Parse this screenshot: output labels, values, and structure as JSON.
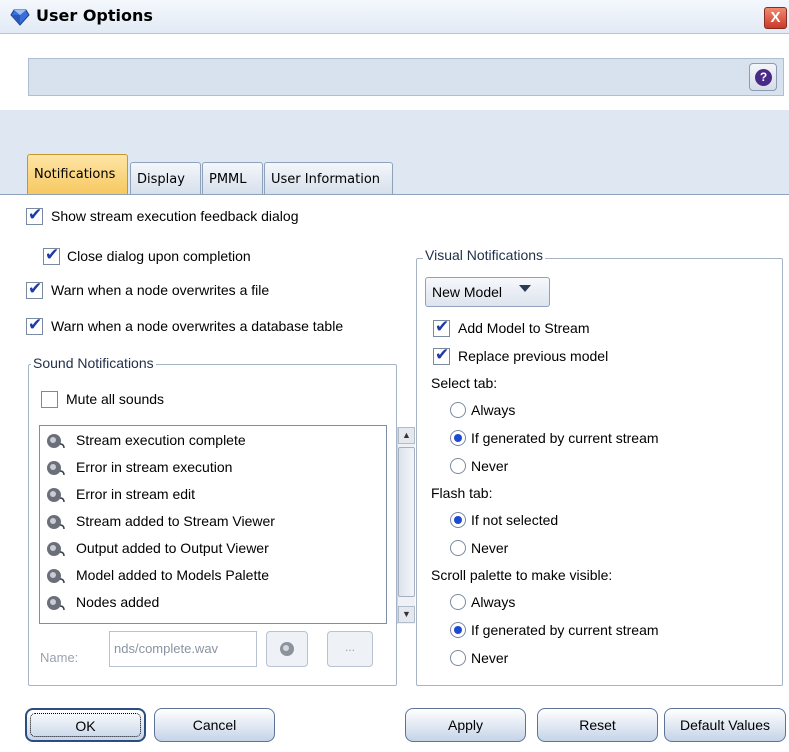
{
  "window": {
    "title": "User Options",
    "close_label": "X",
    "help_label": "?"
  },
  "tabs": [
    {
      "label": "Notifications",
      "active": true
    },
    {
      "label": "Display",
      "active": false
    },
    {
      "label": "PMML",
      "active": false
    },
    {
      "label": "User Information",
      "active": false
    }
  ],
  "left": {
    "show_feedback": {
      "label": "Show stream execution feedback dialog",
      "checked": true
    },
    "close_dialog": {
      "label": "Close dialog upon completion",
      "checked": true
    },
    "warn_file": {
      "label": "Warn when a node overwrites a file",
      "checked": true
    },
    "warn_table": {
      "label": "Warn when a node overwrites a database table",
      "checked": true
    }
  },
  "sound": {
    "title": "Sound Notifications",
    "mute": {
      "label": "Mute all sounds",
      "checked": false
    },
    "items": [
      "Stream execution complete",
      "Error in stream execution",
      "Error in stream edit",
      "Stream added to Stream Viewer",
      "Output added to Output Viewer",
      "Model added to Models Palette",
      "Nodes added"
    ],
    "name_label": "Name:",
    "name_value": "nds/complete.wav",
    "browse_label": "..."
  },
  "visual": {
    "title": "Visual Notifications",
    "dropdown_value": "New Model",
    "add_model": {
      "label": "Add Model to Stream",
      "checked": true
    },
    "replace_model": {
      "label": "Replace previous model",
      "checked": true
    },
    "select_tab": {
      "label": "Select tab:",
      "options": [
        "Always",
        "If generated by current stream",
        "Never"
      ],
      "selected": 1
    },
    "flash_tab": {
      "label": "Flash tab:",
      "options": [
        "If not selected",
        "Never"
      ],
      "selected": 0
    },
    "scroll_palette": {
      "label": "Scroll palette to make visible:",
      "options": [
        "Always",
        "If generated by current stream",
        "Never"
      ],
      "selected": 1
    }
  },
  "buttons": {
    "ok": "OK",
    "cancel": "Cancel",
    "apply": "Apply",
    "reset": "Reset",
    "default": "Default Values"
  },
  "colors": {
    "active_tab": "#f7c860",
    "accent": "#1c4bd0",
    "header": "#d7e2ee"
  }
}
